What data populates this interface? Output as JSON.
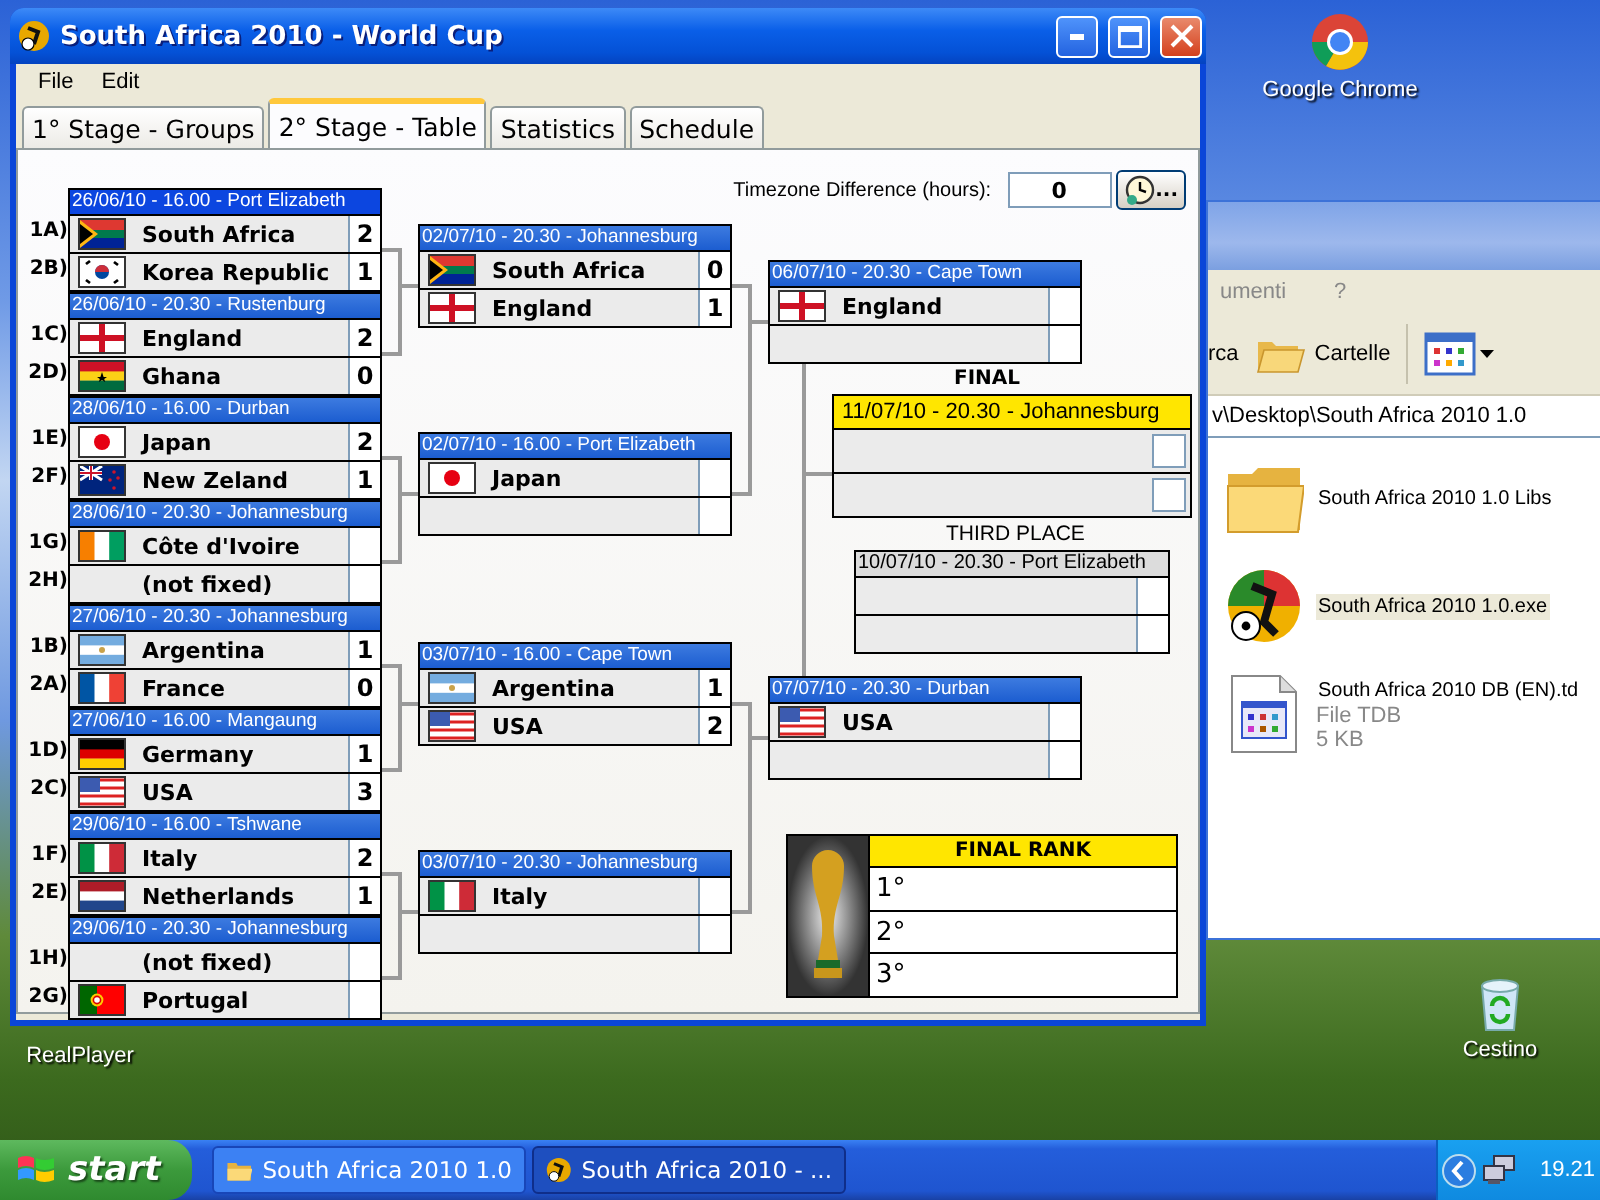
{
  "window": {
    "title": "South Africa 2010 - World Cup"
  },
  "menu": [
    "File",
    "Edit"
  ],
  "tabs": [
    {
      "label": "1° Stage - Groups",
      "selected": false
    },
    {
      "label": "2° Stage - Table",
      "selected": true
    },
    {
      "label": "Statistics",
      "selected": false
    },
    {
      "label": "Schedule",
      "selected": false
    }
  ],
  "timezone": {
    "label": "Timezone Difference (hours):",
    "value": "0",
    "button": "..."
  },
  "round_of_16": [
    {
      "header": "26/06/10 - 16.00 - Port Elizabeth",
      "teams": [
        {
          "seed": "1A)",
          "kind": "za",
          "name": "South Africa",
          "score": "2"
        },
        {
          "seed": "2B)",
          "kind": "kr",
          "name": "Korea Republic",
          "score": "1"
        }
      ]
    },
    {
      "header": "26/06/10 - 20.30 - Rustenburg",
      "teams": [
        {
          "seed": "1C)",
          "kind": "eng",
          "name": "England",
          "score": "2"
        },
        {
          "seed": "2D)",
          "kind": "gh",
          "name": "Ghana",
          "score": "0"
        }
      ]
    },
    {
      "header": "28/06/10 - 16.00 - Durban",
      "teams": [
        {
          "seed": "1E)",
          "kind": "jp",
          "name": "Japan",
          "score": "2"
        },
        {
          "seed": "2F)",
          "kind": "nz",
          "name": "New Zeland",
          "score": "1"
        }
      ]
    },
    {
      "header": "28/06/10 - 20.30 - Johannesburg",
      "teams": [
        {
          "seed": "1G)",
          "kind": "ci",
          "name": "Côte d'Ivoire"
        },
        {
          "seed": "2H)",
          "name": "(not fixed)"
        }
      ]
    },
    {
      "header": "27/06/10 - 20.30 - Johannesburg",
      "teams": [
        {
          "seed": "1B)",
          "kind": "ar",
          "name": "Argentina",
          "score": "1"
        },
        {
          "seed": "2A)",
          "kind": "fr",
          "name": "France",
          "score": "0"
        }
      ]
    },
    {
      "header": "27/06/10 - 16.00 - Mangaung",
      "teams": [
        {
          "seed": "1D)",
          "kind": "de",
          "name": "Germany",
          "score": "1"
        },
        {
          "seed": "2C)",
          "kind": "us",
          "name": "USA",
          "score": "3"
        }
      ]
    },
    {
      "header": "29/06/10 - 16.00 - Tshwane",
      "teams": [
        {
          "seed": "1F)",
          "kind": "it",
          "name": "Italy",
          "score": "2"
        },
        {
          "seed": "2E)",
          "kind": "nl",
          "name": "Netherlands",
          "score": "1"
        }
      ]
    },
    {
      "header": "29/06/10 - 20.30 - Johannesburg",
      "teams": [
        {
          "seed": "1H)",
          "name": "(not fixed)"
        },
        {
          "seed": "2G)",
          "kind": "pt",
          "name": "Portugal"
        }
      ]
    }
  ],
  "quarter_finals": [
    {
      "header": "02/07/10 - 20.30 - Johannesburg",
      "teams": [
        {
          "kind": "za",
          "name": "South Africa",
          "score": "0"
        },
        {
          "kind": "eng",
          "name": "England",
          "score": "1"
        }
      ]
    },
    {
      "header": "02/07/10 - 16.00 - Port Elizabeth",
      "teams": [
        {
          "kind": "jp",
          "name": "Japan"
        }
      ]
    },
    {
      "header": "03/07/10 - 16.00 - Cape Town",
      "teams": [
        {
          "kind": "ar",
          "name": "Argentina",
          "score": "1"
        },
        {
          "kind": "us",
          "name": "USA",
          "score": "2"
        }
      ]
    },
    {
      "header": "03/07/10 - 20.30 - Johannesburg",
      "teams": [
        {
          "kind": "it",
          "name": "Italy"
        }
      ]
    }
  ],
  "semi_finals": [
    {
      "header": "06/07/10 - 20.30 - Cape Town",
      "teams": [
        {
          "kind": "eng",
          "name": "England"
        }
      ]
    },
    {
      "header": "07/07/10 - 20.30 - Durban",
      "teams": [
        {
          "kind": "us",
          "name": "USA"
        }
      ]
    }
  ],
  "final": {
    "label": "FINAL",
    "header": "11/07/10 - 20.30 - Johannesburg"
  },
  "third_place": {
    "label": "THIRD PLACE",
    "header": "10/07/10 - 20.30 - Port Elizabeth"
  },
  "final_rank": {
    "title": "FINAL RANK",
    "places": [
      "1°",
      "2°",
      "3°"
    ]
  },
  "explorer": {
    "menu": [
      "umenti",
      "?"
    ],
    "toolbar": [
      "rca",
      "Cartelle"
    ],
    "address": "v\\Desktop\\South Africa 2010 1.0",
    "files": [
      {
        "kind": "folder",
        "name": "South Africa 2010 1.0 Libs",
        "selected": false
      },
      {
        "kind": "app",
        "name": "South Africa 2010 1.0.exe",
        "selected": true
      },
      {
        "kind": "document",
        "name": "South Africa 2010 DB (EN).td",
        "details": [
          "File TDB",
          "5 KB"
        ],
        "selected": false
      }
    ]
  },
  "desktop_icons": [
    {
      "kind": "browser",
      "label": "Google Chrome"
    },
    {
      "kind": "hidden",
      "label": "RealPlayer"
    },
    {
      "kind": "recycle",
      "label": "Cestino"
    }
  ],
  "taskbar": {
    "start": "start",
    "tasks": [
      {
        "kind": "folder",
        "label": "South Africa 2010 1.0",
        "selected": false
      },
      {
        "kind": "app",
        "label": "South Africa 2010 - ...",
        "selected": true
      }
    ],
    "clock": "19.21"
  }
}
